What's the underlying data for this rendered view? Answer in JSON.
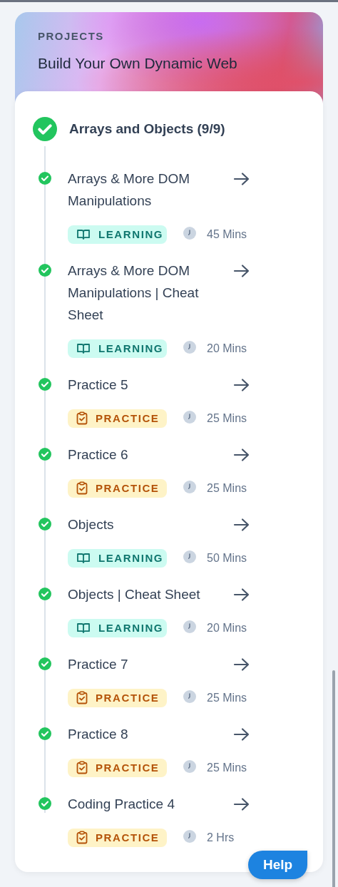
{
  "header": {
    "eyebrow": "PROJECTS",
    "title": "Build Your Own Dynamic Web"
  },
  "section": {
    "title": "Arrays and Objects (9/9)",
    "completed": true
  },
  "items": [
    {
      "title": "Arrays & More DOM Manipulations",
      "kind": "learning",
      "badge": "LEARNING",
      "duration": "45 Mins",
      "completed": true
    },
    {
      "title": "Arrays & More DOM Manipulations | Cheat Sheet",
      "kind": "learning",
      "badge": "LEARNING",
      "duration": "20 Mins",
      "completed": true
    },
    {
      "title": "Practice 5",
      "kind": "practice",
      "badge": "PRACTICE",
      "duration": "25 Mins",
      "completed": true
    },
    {
      "title": "Practice 6",
      "kind": "practice",
      "badge": "PRACTICE",
      "duration": "25 Mins",
      "completed": true
    },
    {
      "title": "Objects",
      "kind": "learning",
      "badge": "LEARNING",
      "duration": "50 Mins",
      "completed": true
    },
    {
      "title": "Objects | Cheat Sheet",
      "kind": "learning",
      "badge": "LEARNING",
      "duration": "20 Mins",
      "completed": true
    },
    {
      "title": "Practice 7",
      "kind": "practice",
      "badge": "PRACTICE",
      "duration": "25 Mins",
      "completed": true
    },
    {
      "title": "Practice 8",
      "kind": "practice",
      "badge": "PRACTICE",
      "duration": "25 Mins",
      "completed": true
    },
    {
      "title": "Coding Practice 4",
      "kind": "practice",
      "badge": "PRACTICE",
      "duration": "2 Hrs",
      "completed": true
    }
  ],
  "help_button": "Help"
}
